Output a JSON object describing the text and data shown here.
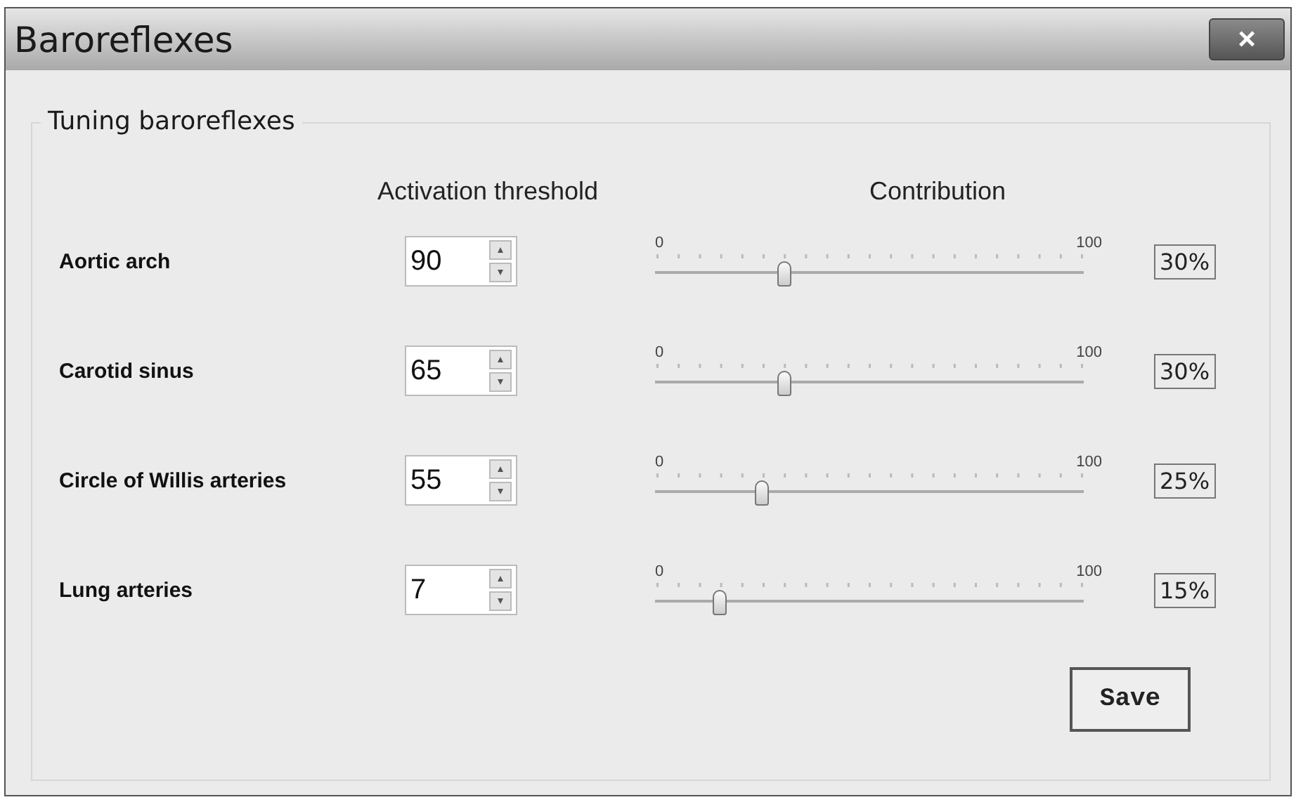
{
  "window": {
    "title": "Baroreflexes",
    "close": "×"
  },
  "group": {
    "title": "Tuning baroreflexes"
  },
  "columns": [
    "Activation threshold",
    "Contribution"
  ],
  "rows": [
    {
      "name": "Aortic arch",
      "threshold": "90",
      "min": "0",
      "max": "100",
      "level": 0.3,
      "reading": "30%"
    },
    {
      "name": "Carotid sinus",
      "threshold": "65",
      "min": "0",
      "max": "100",
      "level": 0.3,
      "reading": "30%"
    },
    {
      "name": "Circle of Willis arteries",
      "threshold": "55",
      "min": "0",
      "max": "100",
      "level": 0.25,
      "reading": "25%"
    },
    {
      "name": "Lung arteries",
      "threshold": "7",
      "min": "0",
      "max": "100",
      "level": 0.15,
      "reading": "15%"
    }
  ],
  "buttons": [
    "Save"
  ]
}
